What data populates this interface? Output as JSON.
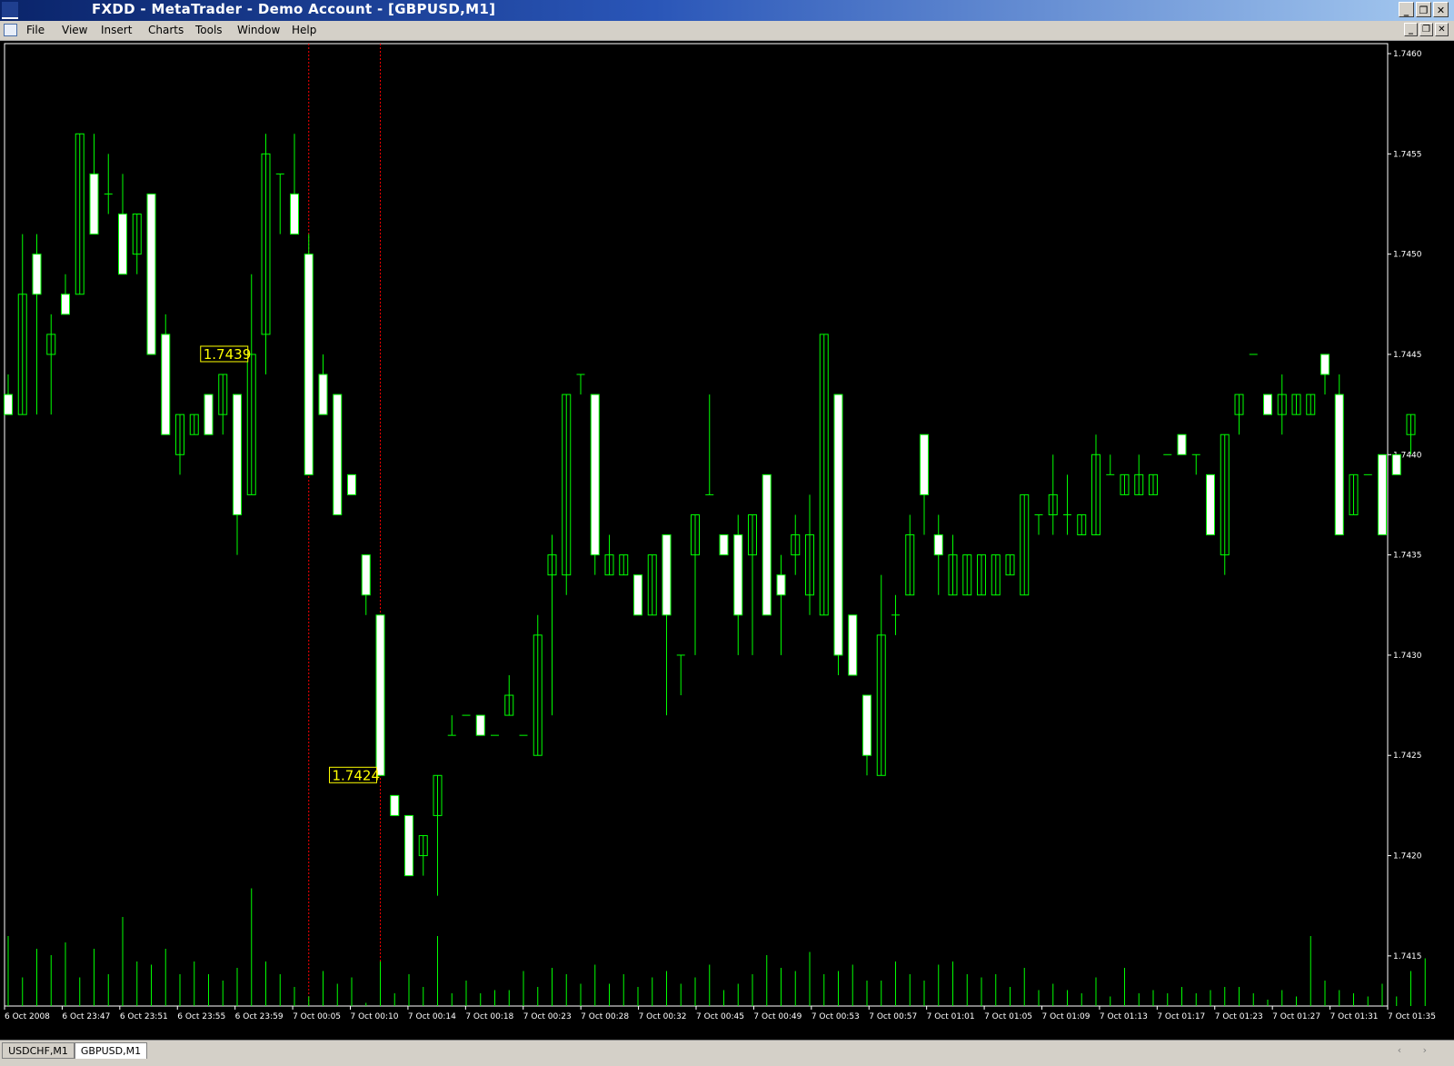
{
  "window": {
    "title": "FXDD - MetaTrader - Demo Account - [GBPUSD,M1]",
    "buttons": [
      "_",
      "❐",
      "✕"
    ]
  },
  "menu": {
    "items": [
      "File",
      "View",
      "Insert",
      "Charts",
      "Tools",
      "Window",
      "Help"
    ],
    "mdi_buttons": [
      "_",
      "❐",
      "✕"
    ]
  },
  "chart_data": {
    "type": "candlestick",
    "symbol": "GBPUSD",
    "timeframe": "M1",
    "ylim": [
      1.74125,
      1.74605
    ],
    "price_ticks": [
      "1.7460",
      "1.7455",
      "1.7450",
      "1.7445",
      "1.7440",
      "1.7435",
      "1.7430",
      "1.7425",
      "1.7420",
      "1.7415"
    ],
    "time_ticks": [
      "6 Oct 2008",
      "6 Oct 23:47",
      "6 Oct 23:51",
      "6 Oct 23:55",
      "6 Oct 23:59",
      "7 Oct 00:05",
      "7 Oct 00:10",
      "7 Oct 00:14",
      "7 Oct 00:18",
      "7 Oct 00:23",
      "7 Oct 00:28",
      "7 Oct 00:32",
      "7 Oct 00:45",
      "7 Oct 00:49",
      "7 Oct 00:53",
      "7 Oct 00:57",
      "7 Oct 01:01",
      "7 Oct 01:05",
      "7 Oct 01:09",
      "7 Oct 01:13",
      "7 Oct 01:17",
      "7 Oct 01:23",
      "7 Oct 01:27",
      "7 Oct 01:31",
      "7 Oct 01:35"
    ],
    "markers": [
      {
        "label": "1.7439",
        "bar": 17
      },
      {
        "label": "1.7424",
        "bar": 26
      }
    ],
    "vlines": [
      21,
      26
    ],
    "colors": {
      "up": "#00ff00",
      "down_fill": "#ffffff",
      "background": "#000000",
      "axis": "#ffffff",
      "marker": "#ffff00",
      "vline": "#ff0000",
      "volume": "#00ff00"
    },
    "ohlc": [
      [
        1.7443,
        1.7444,
        1.7442,
        1.7442
      ],
      [
        1.7442,
        1.7451,
        1.7442,
        1.7448
      ],
      [
        1.745,
        1.7451,
        1.7442,
        1.7448
      ],
      [
        1.7445,
        1.7447,
        1.7442,
        1.7446
      ],
      [
        1.7448,
        1.7449,
        1.7447,
        1.7447
      ],
      [
        1.7448,
        1.7456,
        1.7448,
        1.7456
      ],
      [
        1.7454,
        1.7456,
        1.7451,
        1.7451
      ],
      [
        1.7453,
        1.7455,
        1.7452,
        1.7453
      ],
      [
        1.7452,
        1.7454,
        1.7449,
        1.7449
      ],
      [
        1.745,
        1.7452,
        1.7449,
        1.7452
      ],
      [
        1.7453,
        1.7453,
        1.7445,
        1.7445
      ],
      [
        1.7446,
        1.7447,
        1.7441,
        1.7441
      ],
      [
        1.744,
        1.7442,
        1.7439,
        1.7442
      ],
      [
        1.7441,
        1.7442,
        1.7441,
        1.7442
      ],
      [
        1.7443,
        1.7443,
        1.7441,
        1.7441
      ],
      [
        1.7442,
        1.7444,
        1.7441,
        1.7444
      ],
      [
        1.7443,
        1.7443,
        1.7435,
        1.7437
      ],
      [
        1.7438,
        1.7449,
        1.7438,
        1.7445
      ],
      [
        1.7446,
        1.7456,
        1.7444,
        1.7455
      ],
      [
        1.7454,
        1.7454,
        1.7451,
        1.7454
      ],
      [
        1.7453,
        1.7456,
        1.7451,
        1.7451
      ],
      [
        1.745,
        1.7451,
        1.7439,
        1.7439
      ],
      [
        1.7444,
        1.7445,
        1.7442,
        1.7442
      ],
      [
        1.7443,
        1.7443,
        1.7437,
        1.7437
      ],
      [
        1.7439,
        1.7439,
        1.7438,
        1.7438
      ],
      [
        1.7435,
        1.7435,
        1.7432,
        1.7433
      ],
      [
        1.7432,
        1.7432,
        1.7424,
        1.7424
      ],
      [
        1.7423,
        1.7423,
        1.7422,
        1.7422
      ],
      [
        1.7422,
        1.7422,
        1.7419,
        1.7419
      ],
      [
        1.742,
        1.7421,
        1.7419,
        1.7421
      ],
      [
        1.7422,
        1.7424,
        1.7418,
        1.7424
      ],
      [
        1.7426,
        1.7427,
        1.7426,
        1.7426
      ],
      [
        1.7427,
        1.7427,
        1.7427,
        1.7427
      ],
      [
        1.7427,
        1.7427,
        1.7426,
        1.7426
      ],
      [
        1.7426,
        1.7426,
        1.7426,
        1.7426
      ],
      [
        1.7427,
        1.7429,
        1.7427,
        1.7428
      ],
      [
        1.7426,
        1.7426,
        1.7426,
        1.7426
      ],
      [
        1.7425,
        1.7432,
        1.7425,
        1.7431
      ],
      [
        1.7434,
        1.7436,
        1.7427,
        1.7435
      ],
      [
        1.7434,
        1.7443,
        1.7433,
        1.7443
      ],
      [
        1.7444,
        1.7444,
        1.7443,
        1.7444
      ],
      [
        1.7443,
        1.7443,
        1.7434,
        1.7435
      ],
      [
        1.7434,
        1.7436,
        1.7434,
        1.7435
      ],
      [
        1.7434,
        1.7435,
        1.7434,
        1.7435
      ],
      [
        1.7434,
        1.7434,
        1.7432,
        1.7432
      ],
      [
        1.7432,
        1.7435,
        1.7432,
        1.7435
      ],
      [
        1.7436,
        1.7436,
        1.7427,
        1.7432
      ],
      [
        1.743,
        1.743,
        1.7428,
        1.743
      ],
      [
        1.7435,
        1.7437,
        1.743,
        1.7437
      ],
      [
        1.7438,
        1.7443,
        1.7438,
        1.7438
      ],
      [
        1.7436,
        1.7436,
        1.7435,
        1.7435
      ],
      [
        1.7436,
        1.7437,
        1.743,
        1.7432
      ],
      [
        1.7435,
        1.7437,
        1.743,
        1.7437
      ],
      [
        1.7439,
        1.7439,
        1.7432,
        1.7432
      ],
      [
        1.7434,
        1.7435,
        1.743,
        1.7433
      ],
      [
        1.7435,
        1.7437,
        1.7434,
        1.7436
      ],
      [
        1.7433,
        1.7438,
        1.7432,
        1.7436
      ],
      [
        1.7432,
        1.7446,
        1.7432,
        1.7446
      ],
      [
        1.7443,
        1.7443,
        1.7429,
        1.743
      ],
      [
        1.7432,
        1.7432,
        1.7429,
        1.7429
      ],
      [
        1.7428,
        1.7428,
        1.7424,
        1.7425
      ],
      [
        1.7424,
        1.7434,
        1.7424,
        1.7431
      ],
      [
        1.7432,
        1.7433,
        1.7431,
        1.7432
      ],
      [
        1.7433,
        1.7437,
        1.7433,
        1.7436
      ],
      [
        1.7441,
        1.7441,
        1.7436,
        1.7438
      ],
      [
        1.7436,
        1.7437,
        1.7433,
        1.7435
      ],
      [
        1.7433,
        1.7436,
        1.7433,
        1.7435
      ],
      [
        1.7433,
        1.7435,
        1.7433,
        1.7435
      ],
      [
        1.7433,
        1.7435,
        1.7433,
        1.7435
      ],
      [
        1.7433,
        1.7435,
        1.7433,
        1.7435
      ],
      [
        1.7434,
        1.7435,
        1.7434,
        1.7435
      ],
      [
        1.7433,
        1.7438,
        1.7433,
        1.7438
      ],
      [
        1.7437,
        1.7437,
        1.7436,
        1.7437
      ],
      [
        1.7437,
        1.744,
        1.7436,
        1.7438
      ],
      [
        1.7437,
        1.7439,
        1.7436,
        1.7437
      ],
      [
        1.7436,
        1.7437,
        1.7436,
        1.7437
      ],
      [
        1.7436,
        1.7441,
        1.7436,
        1.744
      ],
      [
        1.7439,
        1.744,
        1.7439,
        1.7439
      ],
      [
        1.7438,
        1.7439,
        1.7438,
        1.7439
      ],
      [
        1.7438,
        1.744,
        1.7438,
        1.7439
      ],
      [
        1.7438,
        1.7439,
        1.7438,
        1.7439
      ],
      [
        1.744,
        1.744,
        1.744,
        1.744
      ],
      [
        1.7441,
        1.7441,
        1.744,
        1.744
      ],
      [
        1.744,
        1.744,
        1.7439,
        1.744
      ],
      [
        1.7439,
        1.7439,
        1.7436,
        1.7436
      ],
      [
        1.7435,
        1.7441,
        1.7434,
        1.7441
      ],
      [
        1.7442,
        1.7443,
        1.7441,
        1.7443
      ],
      [
        1.7445,
        1.7445,
        1.7445,
        1.7445
      ],
      [
        1.7443,
        1.7443,
        1.7442,
        1.7442
      ],
      [
        1.7442,
        1.7444,
        1.7441,
        1.7443
      ],
      [
        1.7442,
        1.7443,
        1.7442,
        1.7443
      ],
      [
        1.7442,
        1.7443,
        1.7442,
        1.7443
      ],
      [
        1.7445,
        1.7445,
        1.7443,
        1.7444
      ],
      [
        1.7443,
        1.7444,
        1.7436,
        1.7436
      ],
      [
        1.7437,
        1.7439,
        1.7437,
        1.7439
      ],
      [
        1.7439,
        1.7439,
        1.7439,
        1.7439
      ],
      [
        1.744,
        1.744,
        1.7436,
        1.7436
      ],
      [
        1.744,
        1.744,
        1.7439,
        1.7439
      ],
      [
        1.7441,
        1.7442,
        1.744,
        1.7442
      ]
    ],
    "volume": [
      22,
      9,
      18,
      16,
      20,
      9,
      18,
      10,
      28,
      14,
      13,
      18,
      10,
      14,
      10,
      8,
      12,
      37,
      14,
      10,
      6,
      3,
      11,
      7,
      9,
      1,
      14,
      4,
      10,
      6,
      22,
      4,
      8,
      4,
      5,
      5,
      11,
      6,
      12,
      10,
      7,
      13,
      7,
      10,
      6,
      9,
      11,
      7,
      9,
      13,
      5,
      7,
      10,
      16,
      12,
      11,
      17,
      10,
      11,
      13,
      8,
      8,
      14,
      10,
      8,
      13,
      14,
      10,
      9,
      10,
      6,
      12,
      5,
      7,
      5,
      4,
      9,
      3,
      12,
      4,
      5,
      4,
      6,
      4,
      5,
      6,
      6,
      4,
      2,
      5,
      3,
      22,
      8,
      5,
      4,
      3,
      7,
      3,
      11,
      15
    ]
  },
  "tabs": [
    {
      "label": "USDCHF,M1",
      "active": false
    },
    {
      "label": "GBPUSD,M1",
      "active": true
    }
  ],
  "tab_scroll": "‹ ›"
}
